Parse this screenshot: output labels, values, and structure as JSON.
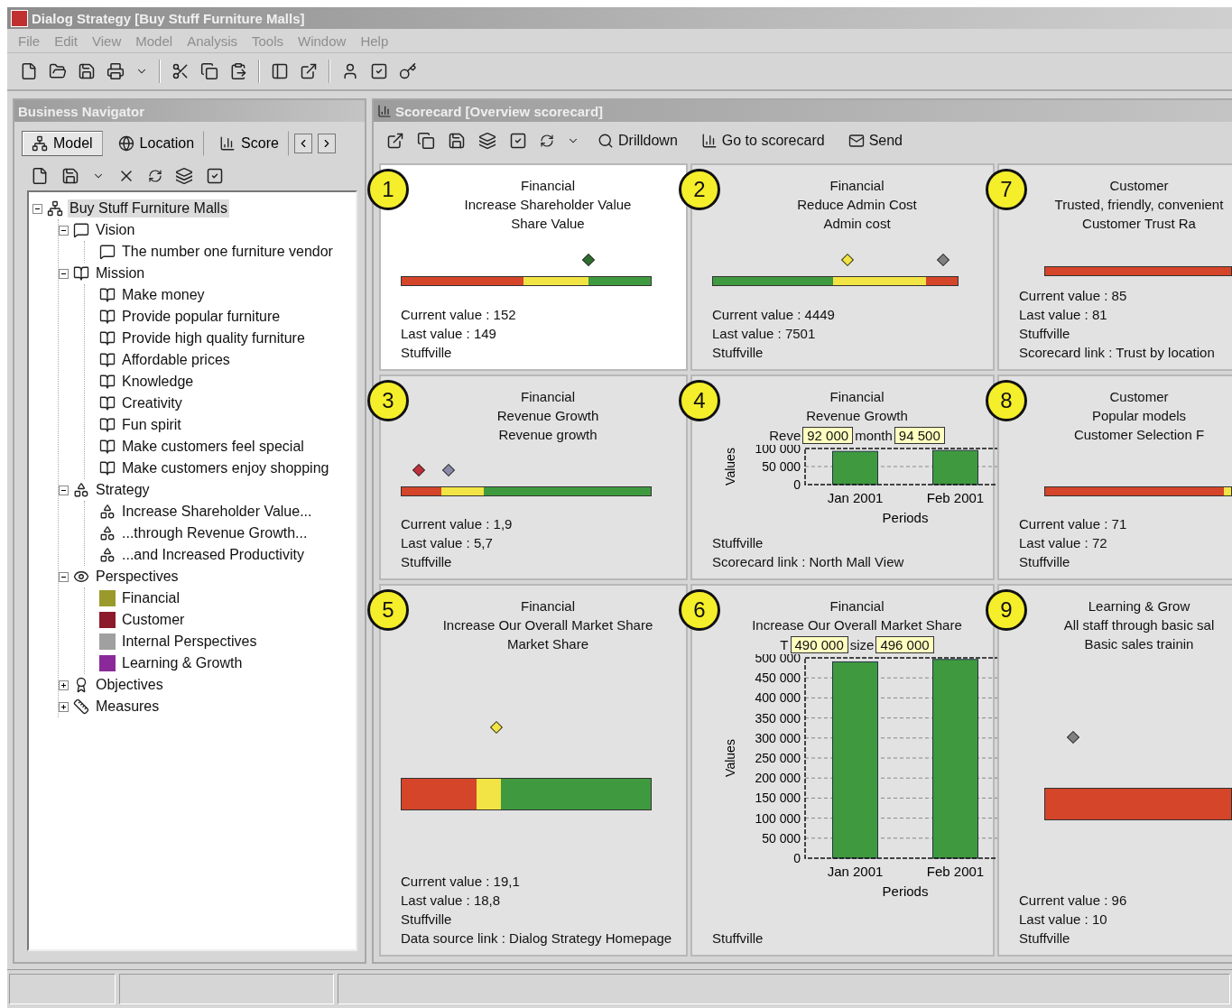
{
  "window": {
    "title": "Dialog Strategy [Buy Stuff Furniture Malls]"
  },
  "menu": [
    "File",
    "Edit",
    "View",
    "Model",
    "Analysis",
    "Tools",
    "Window",
    "Help"
  ],
  "navigator": {
    "title": "Business Navigator",
    "tabs": [
      {
        "label": "Model",
        "kind": "model",
        "selected": true
      },
      {
        "label": "Location",
        "kind": "location",
        "selected": false
      },
      {
        "label": "Score",
        "kind": "scorecard",
        "selected": false
      }
    ],
    "tree": [
      {
        "label": "Buy Stuff Furniture Malls",
        "kind": "model",
        "selected": true,
        "expanded": true,
        "children": [
          {
            "label": "Vision",
            "kind": "vision",
            "selected": false,
            "expanded": true,
            "children": [
              {
                "label": "The number one furniture vendor",
                "kind": "vision",
                "selected": false
              }
            ]
          },
          {
            "label": "Mission",
            "kind": "mission",
            "selected": false,
            "expanded": true,
            "children": [
              {
                "label": "Make money",
                "kind": "mission",
                "selected": false
              },
              {
                "label": "Provide popular furniture",
                "kind": "mission",
                "selected": false
              },
              {
                "label": "Provide high quality furniture",
                "kind": "mission",
                "selected": false
              },
              {
                "label": "Affordable prices",
                "kind": "mission",
                "selected": false
              },
              {
                "label": "Knowledge",
                "kind": "mission",
                "selected": false
              },
              {
                "label": "Creativity",
                "kind": "mission",
                "selected": false
              },
              {
                "label": "Fun spirit",
                "kind": "mission",
                "selected": false
              },
              {
                "label": "Make customers feel special",
                "kind": "mission",
                "selected": false
              },
              {
                "label": "Make customers enjoy shopping",
                "kind": "mission",
                "selected": false
              }
            ]
          },
          {
            "label": "Strategy",
            "kind": "strategy",
            "selected": false,
            "expanded": true,
            "children": [
              {
                "label": "Increase Shareholder Value...",
                "kind": "strategy",
                "selected": false
              },
              {
                "label": "...through Revenue Growth...",
                "kind": "strategy",
                "selected": false
              },
              {
                "label": "...and Increased Productivity",
                "kind": "strategy",
                "selected": false
              }
            ]
          },
          {
            "label": "Perspectives",
            "kind": "perspectives",
            "selected": false,
            "expanded": true,
            "children": [
              {
                "label": "Financial",
                "kind": "perspective",
                "color": "#9a9a2c",
                "selected": false
              },
              {
                "label": "Customer",
                "kind": "perspective",
                "color": "#8b1a2a",
                "selected": false
              },
              {
                "label": "Internal Perspectives",
                "kind": "perspective",
                "color": "#a0a0a0",
                "selected": false
              },
              {
                "label": "Learning & Growth",
                "kind": "perspective",
                "color": "#8a2a9a",
                "selected": false
              }
            ]
          },
          {
            "label": "Objectives",
            "kind": "objectives",
            "selected": false,
            "expanded": false
          },
          {
            "label": "Measures",
            "kind": "measures",
            "selected": false,
            "expanded": false
          }
        ]
      }
    ]
  },
  "scorecard": {
    "title": "Scorecard [Overview scorecard]",
    "actions": [
      {
        "label": "Drilldown",
        "kind": "drilldown"
      },
      {
        "label": "Go to scorecard",
        "kind": "scorecard"
      },
      {
        "label": "Send",
        "kind": "send"
      }
    ],
    "cards": [
      {
        "number": "1",
        "selected": true,
        "kind": "gauge",
        "lines": [
          "Financial",
          "Increase Shareholder Value",
          "Share Value"
        ],
        "segments": [
          {
            "color": "#d4452a"
          },
          {
            "color": "#f2e444"
          },
          {
            "color": "#3f9a3f"
          }
        ],
        "markers": [
          {
            "color": "#2e6e2e",
            "level": 0.75
          }
        ],
        "details": [
          "Current value : 152",
          "Last value : 149",
          "Stuffville"
        ]
      },
      {
        "number": "2",
        "selected": false,
        "kind": "gauge",
        "lines": [
          "Financial",
          "Reduce Admin Cost",
          "Admin cost"
        ],
        "segments": [
          {
            "color": "#3f9a3f"
          },
          {
            "color": "#f2e444"
          },
          {
            "color": "#d4452a"
          }
        ],
        "markers": [
          {
            "color": "#f2e444",
            "level": 0.55
          },
          {
            "color": "#808080",
            "level": 0.94
          }
        ],
        "details": [
          "Current value : 4449",
          "Last value : 7501",
          "Stuffville"
        ]
      },
      {
        "number": "7",
        "selected": false,
        "kind": "gauge",
        "lines": [
          "Customer",
          "Trusted, friendly, convenient",
          "Customer Trust Ra"
        ],
        "segments": [
          {
            "color": "#d4452a"
          }
        ],
        "details": [
          "Current value : 85",
          "Last value : 81",
          "Stuffville",
          "Scorecard link : Trust by location"
        ]
      },
      {
        "number": "3",
        "selected": false,
        "kind": "gauge",
        "lines": [
          "Financial",
          "Revenue Growth",
          "Revenue growth"
        ],
        "segments": [
          {
            "color": "#d4452a"
          },
          {
            "color": "#f2e444"
          },
          {
            "color": "#3f9a3f"
          }
        ],
        "markers": [
          {
            "color": "#c0303a",
            "level": 0.07
          },
          {
            "color": "#8a8aa8",
            "level": 0.19
          }
        ],
        "details": [
          "Current value : 1,9",
          "Last value : 5,7",
          "Stuffville"
        ]
      },
      {
        "number": "4",
        "selected": false,
        "kind": "chart",
        "lines": [
          "Financial",
          "Revenue Growth"
        ],
        "covered_line": [
          "Reve",
          "month"
        ],
        "chart_data": {
          "type": "bar",
          "xlabel": "Periods",
          "ylabel": "Values",
          "categories": [
            "Jan 2001",
            "Feb 2001"
          ],
          "grid": true,
          "series": [
            {
              "color": "#3f9a3f",
              "values": [
                92000,
                94500
              ]
            }
          ],
          "ylim": [
            0,
            100000
          ],
          "yticks": [
            {
              "value": 0,
              "label": "0"
            },
            {
              "value": 50000,
              "label": "50 000"
            },
            {
              "value": 100000,
              "label": "100 000"
            }
          ],
          "value_labels": [
            "92 000",
            "94 500"
          ]
        },
        "details": [
          "Stuffville",
          "Scorecard link : North Mall View"
        ]
      },
      {
        "number": "8",
        "selected": false,
        "kind": "gauge",
        "lines": [
          "Customer",
          "Popular models",
          "Customer Selection F"
        ],
        "segments": [
          {
            "color": "#d4452a"
          },
          {
            "color": "#f2e444"
          }
        ],
        "details": [
          "Current value : 71",
          "Last value : 72",
          "Stuffville"
        ]
      },
      {
        "number": "5",
        "selected": false,
        "kind": "gauge",
        "lines": [
          "Financial",
          "Increase Our Overall Market Share",
          "Market Share"
        ],
        "segments": [
          {
            "color": "#d4452a"
          },
          {
            "color": "#f2e444"
          },
          {
            "color": "#3f9a3f"
          }
        ],
        "markers": [
          {
            "color": "#f2e444",
            "level": 0.38
          }
        ],
        "details": [
          "Current value : 19,1",
          "Last value : 18,8",
          "Stuffville",
          "Data source link : Dialog Strategy Homepage"
        ]
      },
      {
        "number": "6",
        "selected": false,
        "kind": "chart",
        "lines": [
          "Financial",
          "Increase Our Overall Market Share"
        ],
        "covered_line": [
          "T",
          "size"
        ],
        "chart_data": {
          "type": "bar",
          "xlabel": "Periods",
          "ylabel": "Values",
          "categories": [
            "Jan 2001",
            "Feb 2001"
          ],
          "grid": true,
          "series": [
            {
              "color": "#3f9a3f",
              "values": [
                490000,
                496000
              ]
            }
          ],
          "ylim": [
            0,
            500000
          ],
          "yticks": [
            {
              "value": 0,
              "label": "0"
            },
            {
              "value": 50000,
              "label": "50 000"
            },
            {
              "value": 100000,
              "label": "100 000"
            },
            {
              "value": 150000,
              "label": "150 000"
            },
            {
              "value": 200000,
              "label": "200 000"
            },
            {
              "value": 250000,
              "label": "250 000"
            },
            {
              "value": 300000,
              "label": "300 000"
            },
            {
              "value": 350000,
              "label": "350 000"
            },
            {
              "value": 400000,
              "label": "400 000"
            },
            {
              "value": 450000,
              "label": "450 000"
            },
            {
              "value": 500000,
              "label": "500 000"
            }
          ],
          "value_labels": [
            "490 000",
            "496 000"
          ]
        },
        "details": [
          "Stuffville"
        ]
      },
      {
        "number": "9",
        "selected": false,
        "kind": "gauge",
        "lines": [
          "Learning & Grow",
          "All staff through basic sal",
          "Basic sales trainin"
        ],
        "segments": [
          {
            "color": "#d4452a"
          }
        ],
        "markers": [
          {
            "color": "#808080",
            "level": 0.15
          }
        ],
        "details": [
          "Current value : 96",
          "Last value : 10",
          "Stuffville"
        ]
      }
    ]
  }
}
